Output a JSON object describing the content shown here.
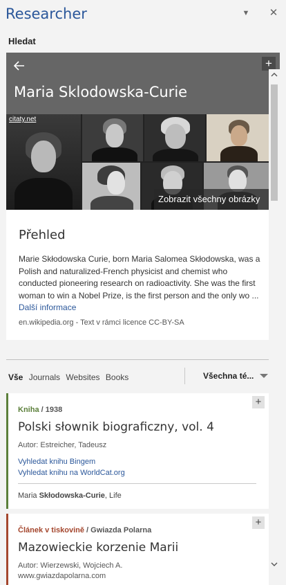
{
  "pane": {
    "title": "Researcher",
    "dropdown_icon": "chevron-down-icon",
    "close_icon": "close-icon"
  },
  "search_label": "Hledat",
  "entity": {
    "name": "Maria Sklodowska-Curie",
    "back_icon": "back-arrow-icon",
    "add_icon": "plus-icon"
  },
  "images": {
    "source_label": "citaty.net",
    "show_all_label": "Zobrazit všechny obrázky"
  },
  "overview": {
    "title": "Přehled",
    "text": "Marie Skłodowska Curie, born Maria Salomea Skłodowska, was a Polish and naturalized-French physicist and chemist who conducted pioneering research on radioactivity. She was the first woman to win a Nobel Prize, is the first person and the only wo ... ",
    "more_label": "Další informace",
    "source": "en.wikipedia.org",
    "license": "Text v rámci licence CC-BY-SA"
  },
  "filters": {
    "tabs": [
      "Vše",
      "Journals",
      "Websites",
      "Books"
    ],
    "scope_label": "Všechna té..."
  },
  "results": [
    {
      "type": "Kniha",
      "sub": "1938",
      "title": "Polski słownik biograficzny, vol. 4",
      "author": "Autor: Estreicher, Tadeusz",
      "links": [
        "Vyhledat knihu Bingem",
        "Vyhledat knihu na WorldCat.org"
      ],
      "context_pre": "Maria ",
      "context_bold": "Skłodowska-Curie",
      "context_post": ", Life",
      "accent": "#5b7f3a"
    },
    {
      "type": "Článek v tiskovině",
      "sub": "Gwiazda Polarna",
      "title": "Mazowieckie korzenie Marii",
      "author": "Autor: Wierzewski, Wojciech A.",
      "url": "www.gwiazdapolarna.com",
      "accent": "#a4462d"
    }
  ],
  "colors": {
    "accent": "#2b579a",
    "banner": "#666666",
    "book": "#5b7f3a",
    "article": "#a4462d"
  }
}
